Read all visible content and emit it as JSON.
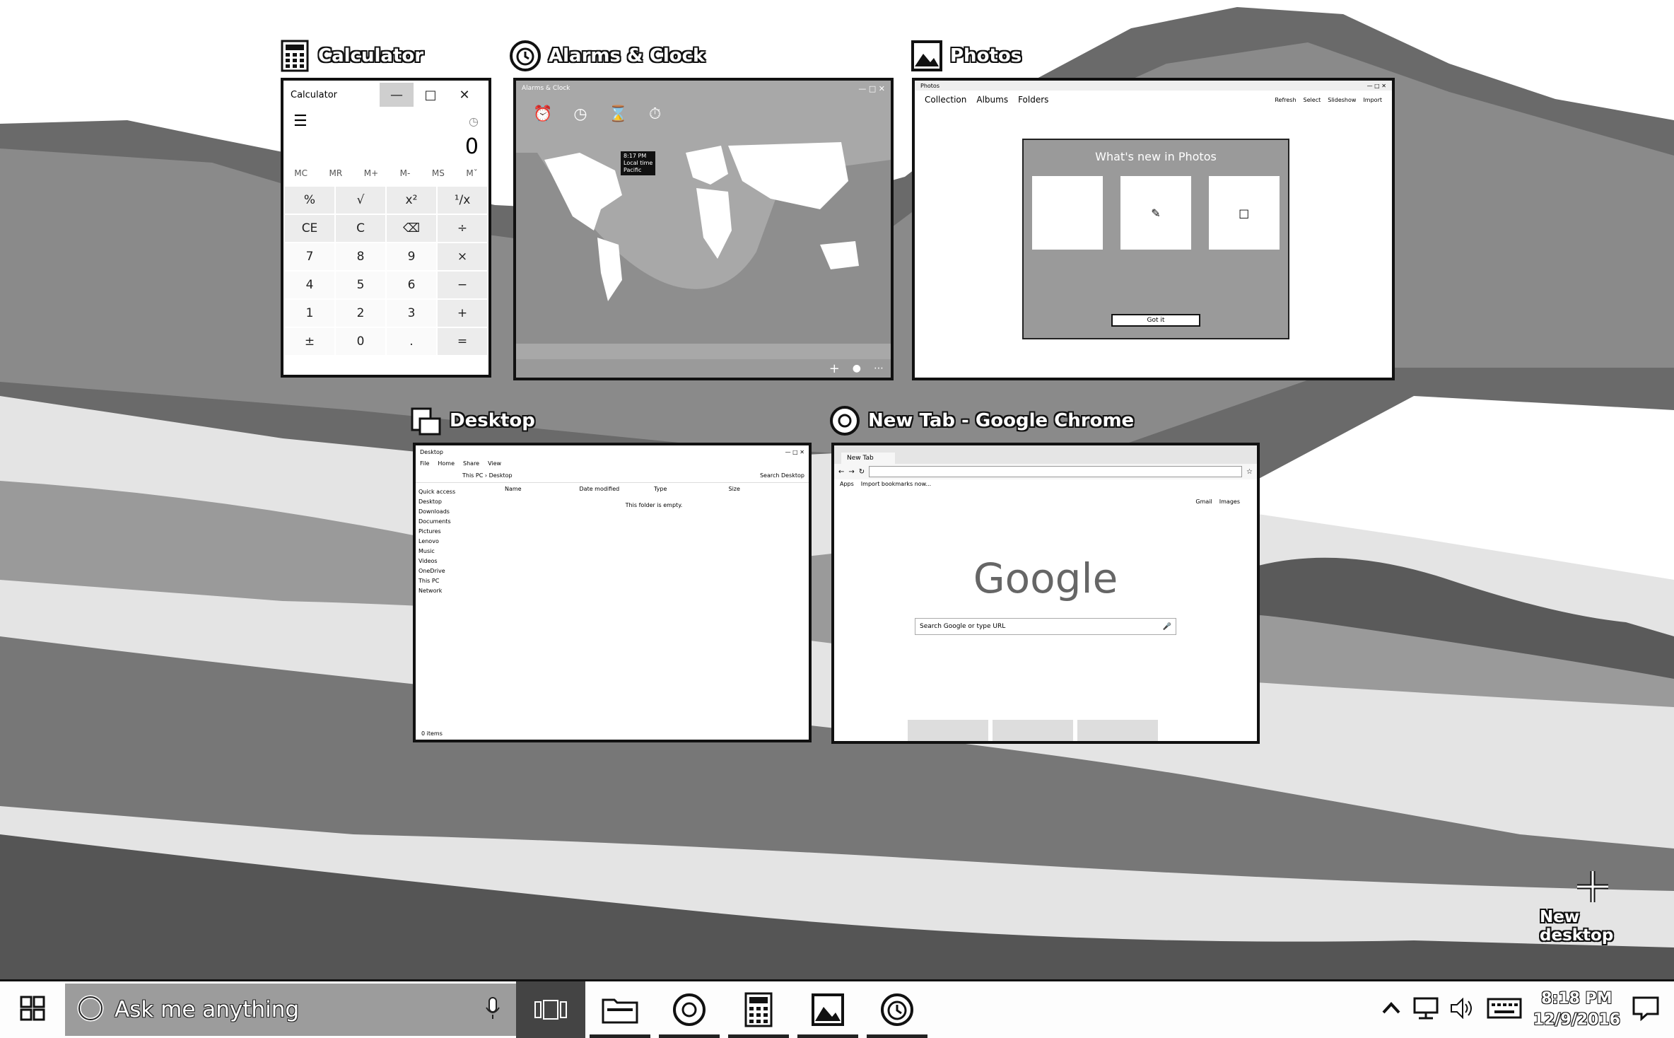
{
  "windows": {
    "calculator": {
      "title": "Calculator",
      "app_header": "Calculator",
      "display": "0",
      "memory": [
        "MC",
        "MR",
        "M+",
        "M-",
        "MS",
        "Mˇ"
      ],
      "keys": [
        "%",
        "√",
        "x²",
        "¹/x",
        "CE",
        "C",
        "⌫",
        "÷",
        "7",
        "8",
        "9",
        "×",
        "4",
        "5",
        "6",
        "−",
        "1",
        "2",
        "3",
        "+",
        "±",
        "0",
        ".",
        "="
      ]
    },
    "alarms": {
      "title": "Alarms & Clock",
      "header": "Alarms & Clock",
      "local_time": "8:17 PM",
      "local_label": "Local time",
      "local_sub": "Pacific"
    },
    "photos": {
      "title": "Photos",
      "header": "Photos",
      "tabs": [
        "Collection",
        "Albums",
        "Folders"
      ],
      "actions": [
        "Refresh",
        "Select",
        "Slideshow",
        "Import"
      ],
      "dialog_title": "What's new in Photos",
      "button": "Got it"
    },
    "desktop": {
      "title": "Desktop",
      "window_title": "Desktop",
      "ribbon": [
        "File",
        "Home",
        "Share",
        "View"
      ],
      "path": "This PC › Desktop",
      "search_placeholder": "Search Desktop",
      "columns": [
        "Name",
        "Date modified",
        "Type",
        "Size"
      ],
      "empty_msg": "This folder is empty.",
      "nav": [
        "Quick access",
        "Desktop",
        "Downloads",
        "Documents",
        "Pictures",
        "Lenovo",
        "Music",
        "Videos",
        "OneDrive",
        "This PC",
        "Network"
      ],
      "status": "0 items"
    },
    "chrome": {
      "title": "New Tab - Google Chrome",
      "tab": "New Tab",
      "bookmarks": [
        "Apps",
        "Import bookmarks now..."
      ],
      "top_links": [
        "Gmail",
        "Images"
      ],
      "logo": "Google",
      "search_placeholder": "Search Google or type URL"
    }
  },
  "new_desktop_label": "New desktop",
  "taskbar": {
    "search_placeholder": "Ask me anything",
    "time": "8:18 PM",
    "date": "12/9/2016"
  }
}
